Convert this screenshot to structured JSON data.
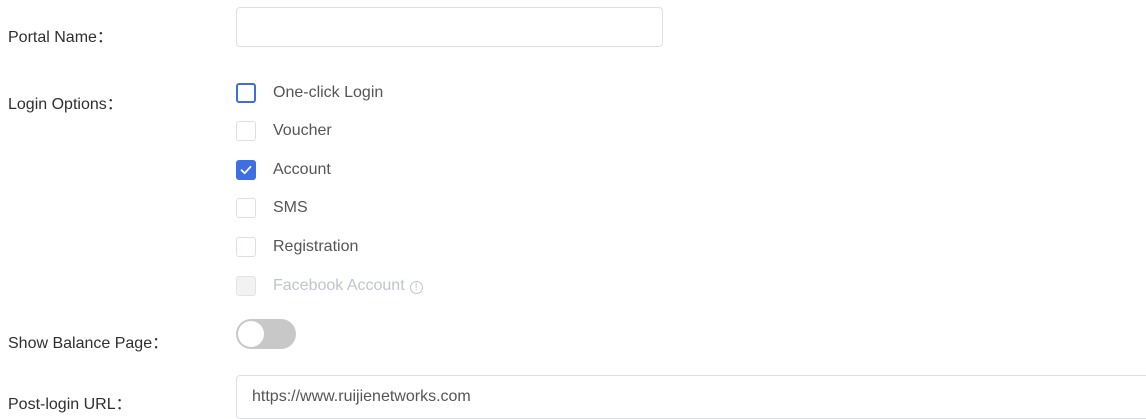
{
  "form": {
    "portal_name": {
      "label": "Portal Name：",
      "value": "",
      "placeholder": ""
    },
    "login_options": {
      "label": "Login Options：",
      "options": [
        {
          "label": "One-click Login",
          "checked": false,
          "disabled": false
        },
        {
          "label": "Voucher",
          "checked": false,
          "disabled": false
        },
        {
          "label": "Account",
          "checked": true,
          "disabled": false
        },
        {
          "label": "SMS",
          "checked": false,
          "disabled": false
        },
        {
          "label": "Registration",
          "checked": false,
          "disabled": false
        },
        {
          "label": "Facebook Account",
          "checked": false,
          "disabled": true
        }
      ]
    },
    "show_balance_page": {
      "label": "Show Balance Page：",
      "enabled": false
    },
    "post_login_url": {
      "label": "Post-login URL：",
      "value": "https://www.ruijienetworks.com"
    }
  },
  "icons": {
    "info": "info-circle-icon",
    "check": "checkmark-icon"
  },
  "colors": {
    "accent": "#3d6fe0",
    "toggle_off": "#c8c8c8",
    "disabled_text": "#c0c4cc"
  }
}
